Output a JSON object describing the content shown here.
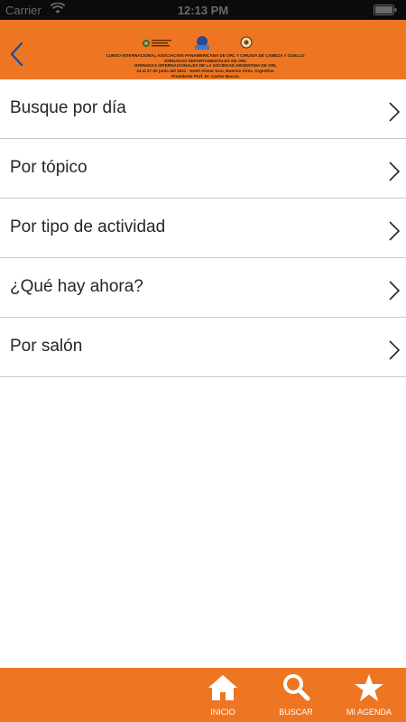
{
  "status_bar": {
    "carrier": "Carrier",
    "time": "12:13 PM"
  },
  "header": {
    "banner_lines": [
      "CURSO INTERNACIONAL ASOCIACION PANAMERICANA DE ORL Y CIRUGIA DE CABEZA Y CUELLO",
      "JORNADAS DEPARTAMENTALES DE ORL",
      "JORNADAS INTERNACIONALES DE LA SOCIEDAD ARGENTINA DE ORL",
      "24 al 27 de junio del 2021 · Hotel Alvear Icon, Buenos Aires, Argentina",
      "Presidente Prof. Dr. Carlos Boccio"
    ]
  },
  "menu": {
    "items": [
      {
        "label": "Busque por día"
      },
      {
        "label": "Por tópico"
      },
      {
        "label": "Por tipo de actividad"
      },
      {
        "label": "¿Qué hay ahora?"
      },
      {
        "label": "Por salón"
      }
    ]
  },
  "tab_bar": {
    "tabs": [
      {
        "label": "INICIO",
        "icon": "home-icon"
      },
      {
        "label": "BUSCAR",
        "icon": "search-icon"
      },
      {
        "label": "MI AGENDA",
        "icon": "star-icon"
      }
    ]
  },
  "colors": {
    "brand_orange": "#ee7622",
    "status_bar_bg": "#0b0b0b",
    "separator": "#c8c8cc",
    "text": "#262626"
  }
}
